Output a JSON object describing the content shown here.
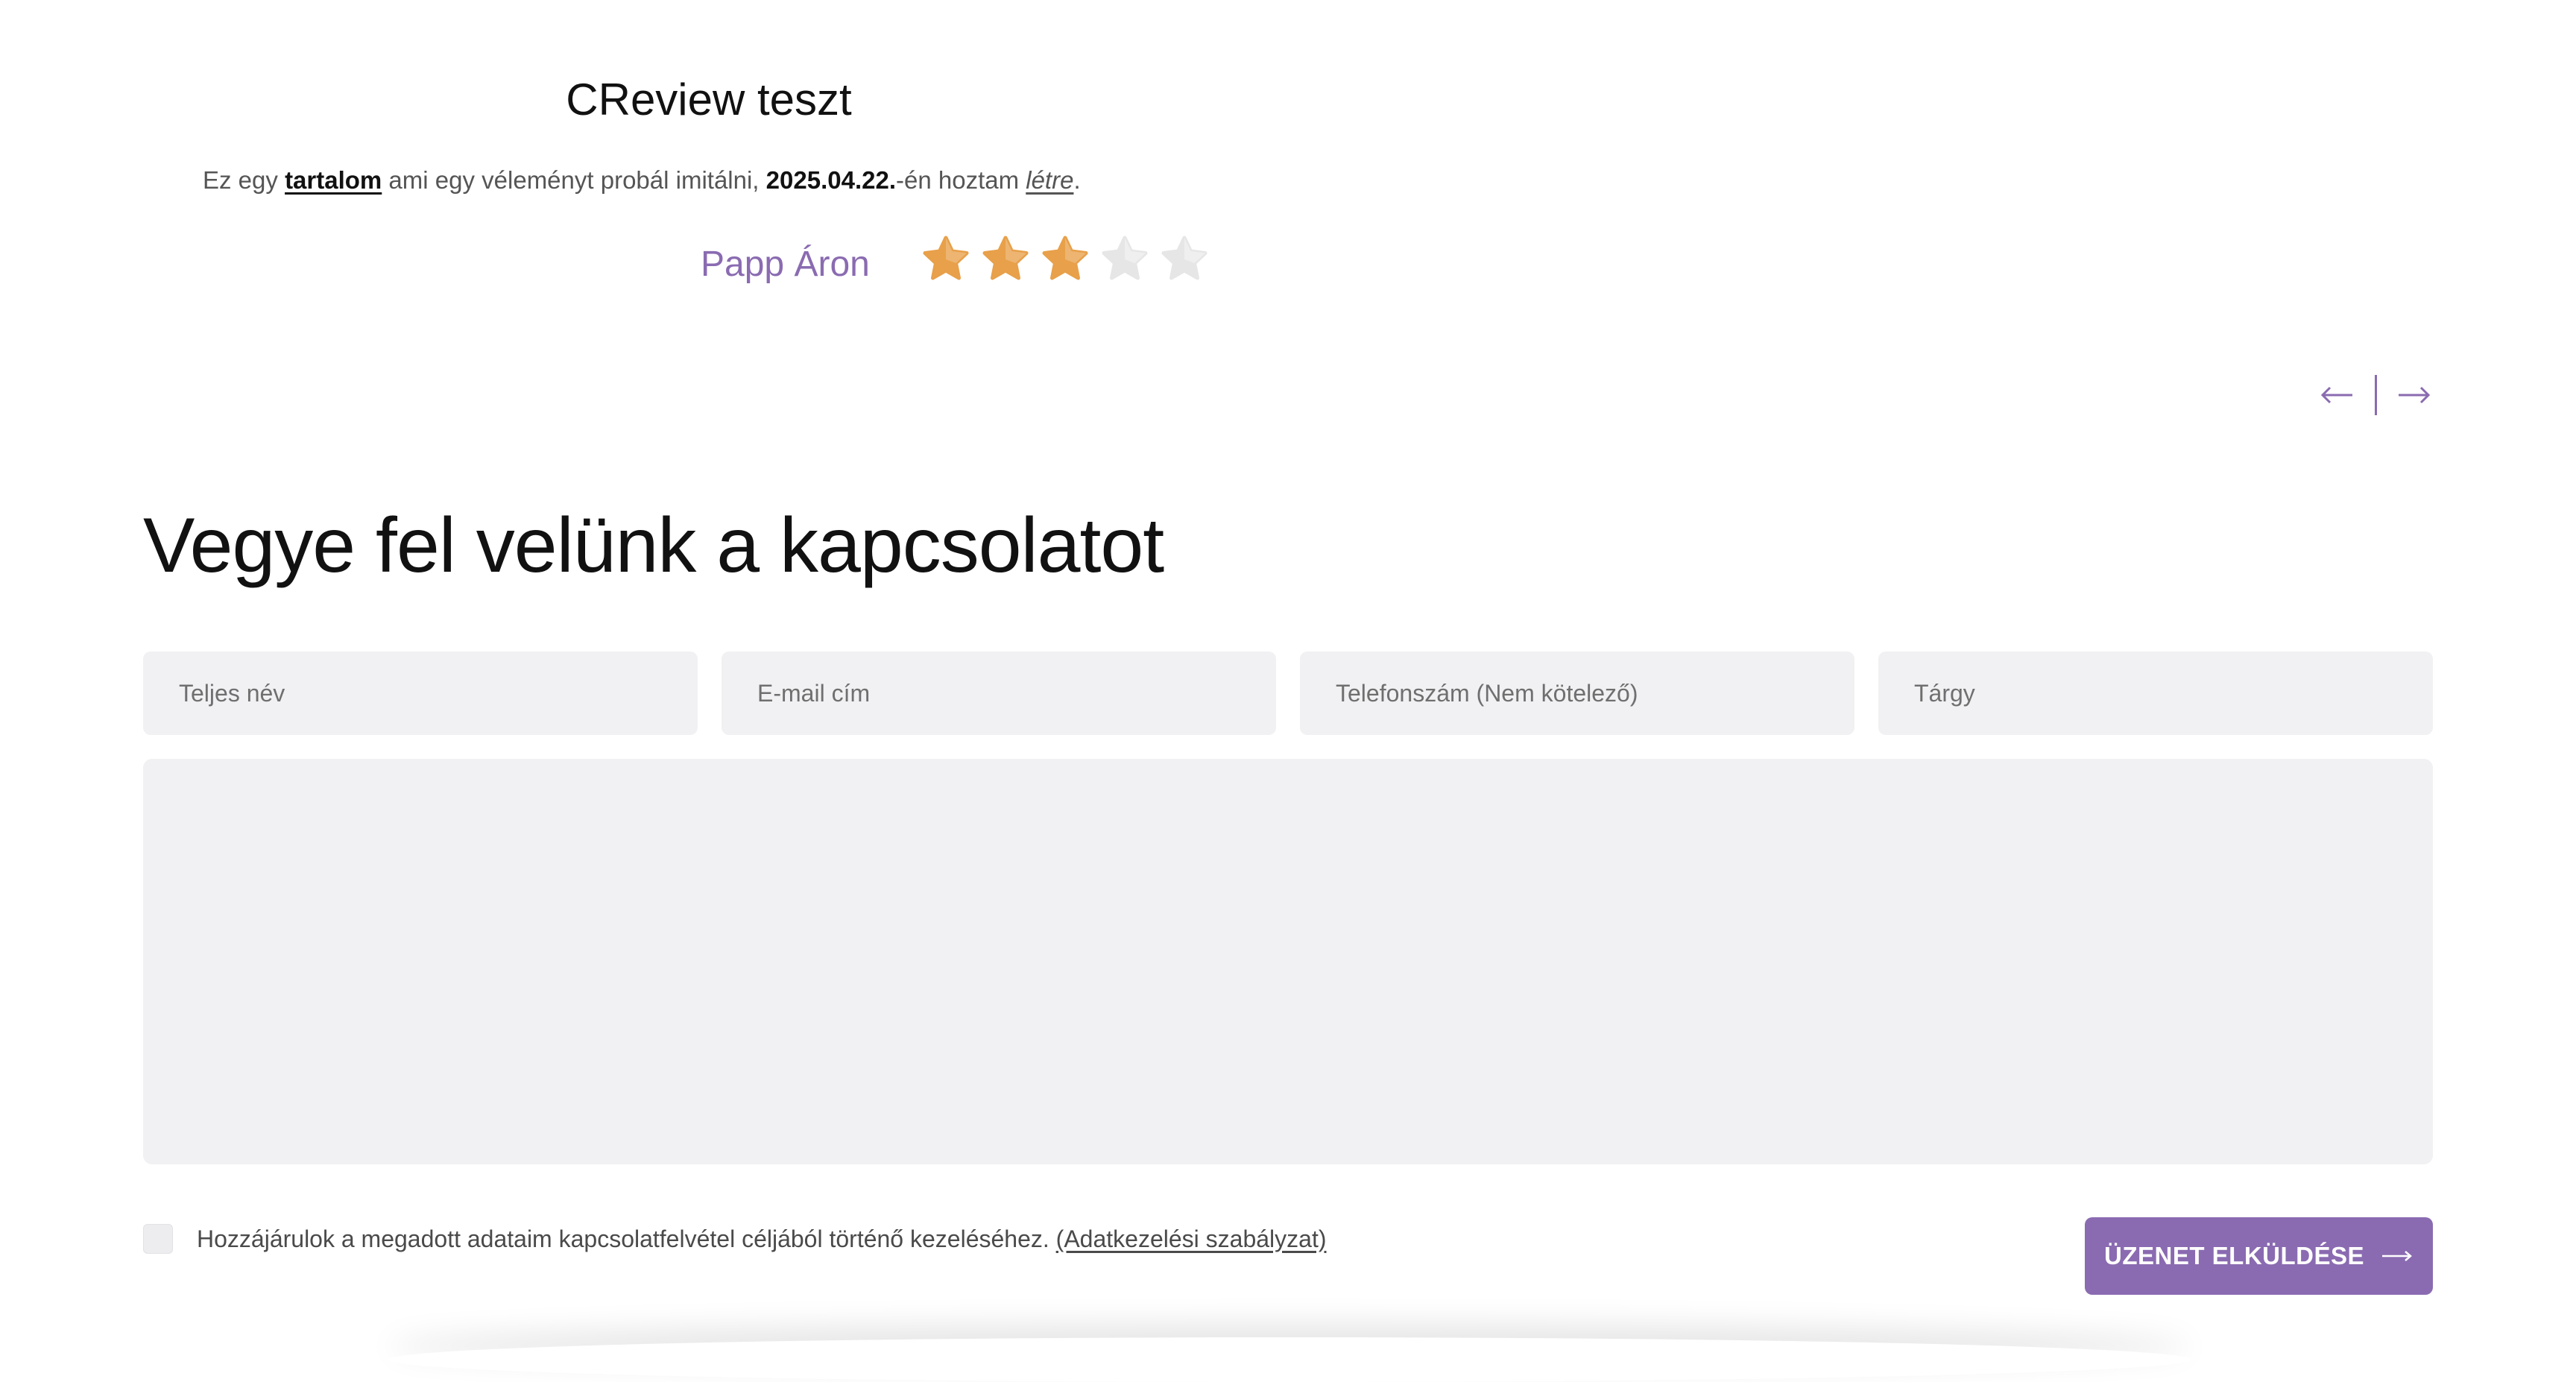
{
  "review": {
    "title": "CReview teszt",
    "body": {
      "part1": "Ez egy ",
      "content_link": "tartalom",
      "part2": " ami egy véleményt probál imitálni, ",
      "date": "2025.04.22.",
      "part3": "-én hoztam ",
      "created_link": "létre",
      "part4": "."
    },
    "author": "Papp Áron",
    "rating": 3,
    "rating_max": 5,
    "star_filled_color": "#e8a04a",
    "star_empty_color": "#e6e6e6"
  },
  "slider": {
    "prev_icon": "arrow-left-icon",
    "next_icon": "arrow-right-icon"
  },
  "contact": {
    "heading": "Vegye fel velünk a kapcsolatot",
    "fields": {
      "full_name_placeholder": "Teljes név",
      "email_placeholder": "E-mail cím",
      "phone_placeholder": "Telefonszám (Nem kötelező)",
      "subject_placeholder": "Tárgy",
      "message_placeholder": ""
    },
    "consent_text": "Hozzájárulok a megadott adataim kapcsolatfelvétel céljából történő kezeléséhez.",
    "consent_link": "(Adatkezelési szabályzat)",
    "submit_label": "ÜZENET ELKÜLDÉSE"
  },
  "colors": {
    "accent": "#8a6bb1",
    "field_bg": "#f1f1f3"
  }
}
